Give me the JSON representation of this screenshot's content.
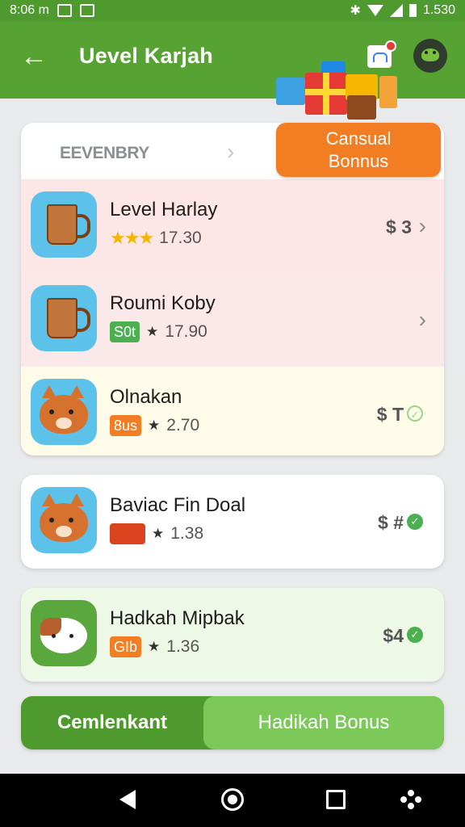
{
  "status_bar": {
    "time_left": "8:06 m",
    "time_right": "1.530"
  },
  "app_bar": {
    "back_icon": "arrow-left-icon",
    "title": "Uevel Karjah"
  },
  "badge": {
    "line1": "Cansual",
    "line2": "Bonnus"
  },
  "category": {
    "label": "EEVENBRY",
    "chevron": "›"
  },
  "list": [
    {
      "title": "Level Harlay",
      "stars": "★★★",
      "rating": "17.30",
      "price": "$ 3",
      "trailing": "›",
      "icon": "mug-icon"
    },
    {
      "title": "Roumi Koby",
      "tag": "S0t",
      "rating": "17.90",
      "trailing": "›",
      "icon": "mug-icon"
    },
    {
      "title": "Olnakan",
      "tag": "8us",
      "rating": "2.70",
      "price": "$ T",
      "trailing": "✓",
      "icon": "fox-icon"
    }
  ],
  "cards": [
    {
      "title": "Baviac Fin Doal",
      "rating": "1.38",
      "price": "$ #",
      "icon": "fox-icon"
    },
    {
      "title": "Hadkah Mipbak",
      "tag": "GIb",
      "rating": "1.36",
      "price": "$4",
      "icon": "dog-icon"
    }
  ],
  "segmented": {
    "left": "Cemlenkant",
    "right": "Hadikah Bonus"
  },
  "colors": {
    "primary": "#56a334",
    "accent": "#f37d22",
    "highlight": "#7cc95a"
  }
}
